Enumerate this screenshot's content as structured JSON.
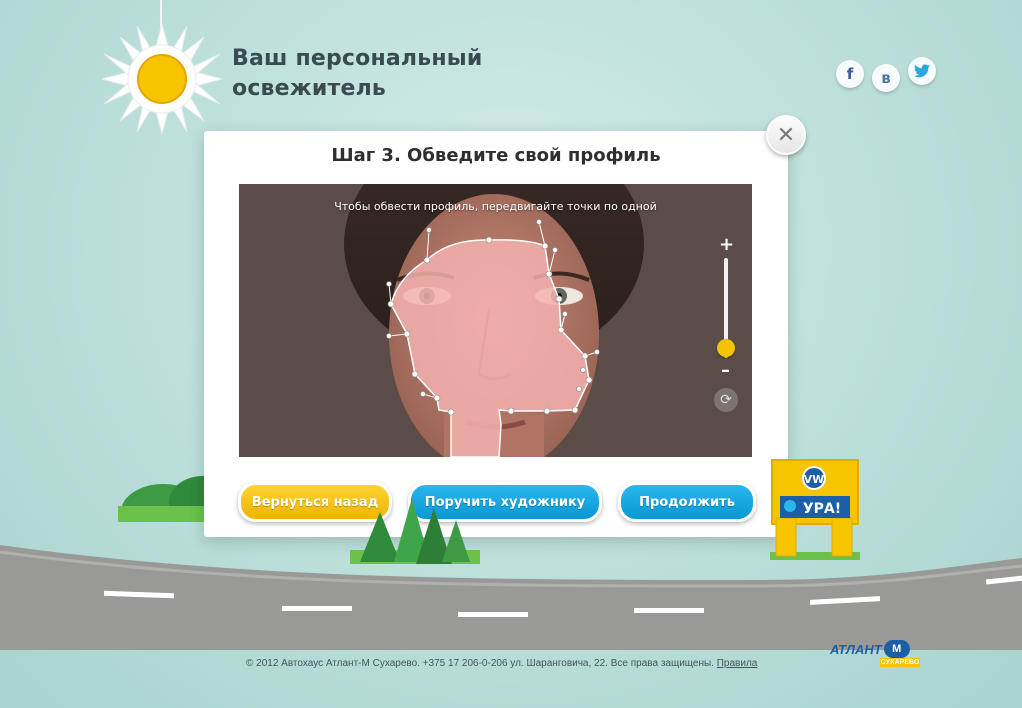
{
  "header": {
    "title_line1": "Ваш персональный",
    "title_line2": "освежитель"
  },
  "social": {
    "facebook": "f",
    "vkontakte": "в",
    "twitter": "twitter-icon"
  },
  "modal": {
    "title": "Шаг 3. Обведите свой профиль",
    "hint": "Чтобы обвести профиль, передвигайте точки по одной",
    "close_label": "✕",
    "zoom_plus": "+",
    "zoom_minus": "–",
    "zoom_level": 0.1,
    "buttons": {
      "back": "Вернуться назад",
      "artist": "Поручить художнику",
      "next": "Продолжить"
    }
  },
  "gate": {
    "label": "УРА!",
    "brand": "VW"
  },
  "footer": {
    "text": "© 2012 Автохаус Атлант-М Сухарево. +375 17 206-0-206 ул. Шаранговича, 22. Все права защищены.",
    "rules_link": "Правила",
    "logo_text": "АТЛАНТ",
    "logo_sub": "СУХАРЕВО",
    "logo_mark": "М"
  },
  "colors": {
    "background": "#bfe1dc",
    "accent_yellow": "#f3c300",
    "accent_blue": "#0898d4"
  }
}
